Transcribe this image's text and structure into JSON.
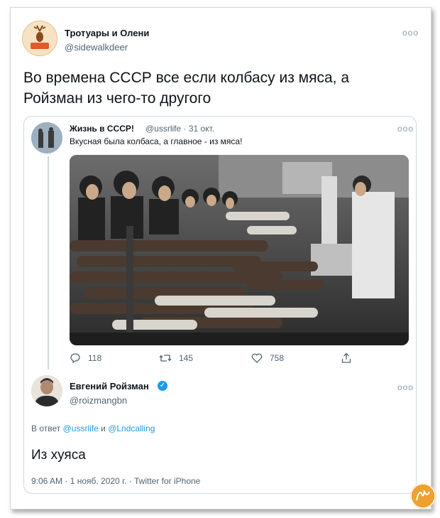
{
  "author": {
    "name": "Тротуары и Олени",
    "handle": "@sidewalkdeer"
  },
  "tweet": {
    "text": "Во времена СССР все если колбасу из мяса, а Ройзман из чего-то другого"
  },
  "more_glyph": "ооо",
  "quote": {
    "name": "Жизнь в СССР!",
    "handle": "@ussrlife · 31 окт.",
    "text": "Вкусная была колбаса, а главное - из мяса!",
    "stats": {
      "replies": "118",
      "retweets": "145",
      "likes": "758"
    }
  },
  "reply": {
    "name": "Евгений Ройзман",
    "handle": "@roizmangbn",
    "reply_prefix": "В ответ",
    "mention_1": "@ussrlife",
    "conjunction": "и",
    "mention_2": "@Lndcalling",
    "text": "Из хуяса",
    "meta": "9:06 AM · 1 нояб. 2020 г. · Twitter for iPhone"
  },
  "colors": {
    "accent": "#1d9bf0",
    "muted": "#536471",
    "logo": "#f0a030"
  }
}
